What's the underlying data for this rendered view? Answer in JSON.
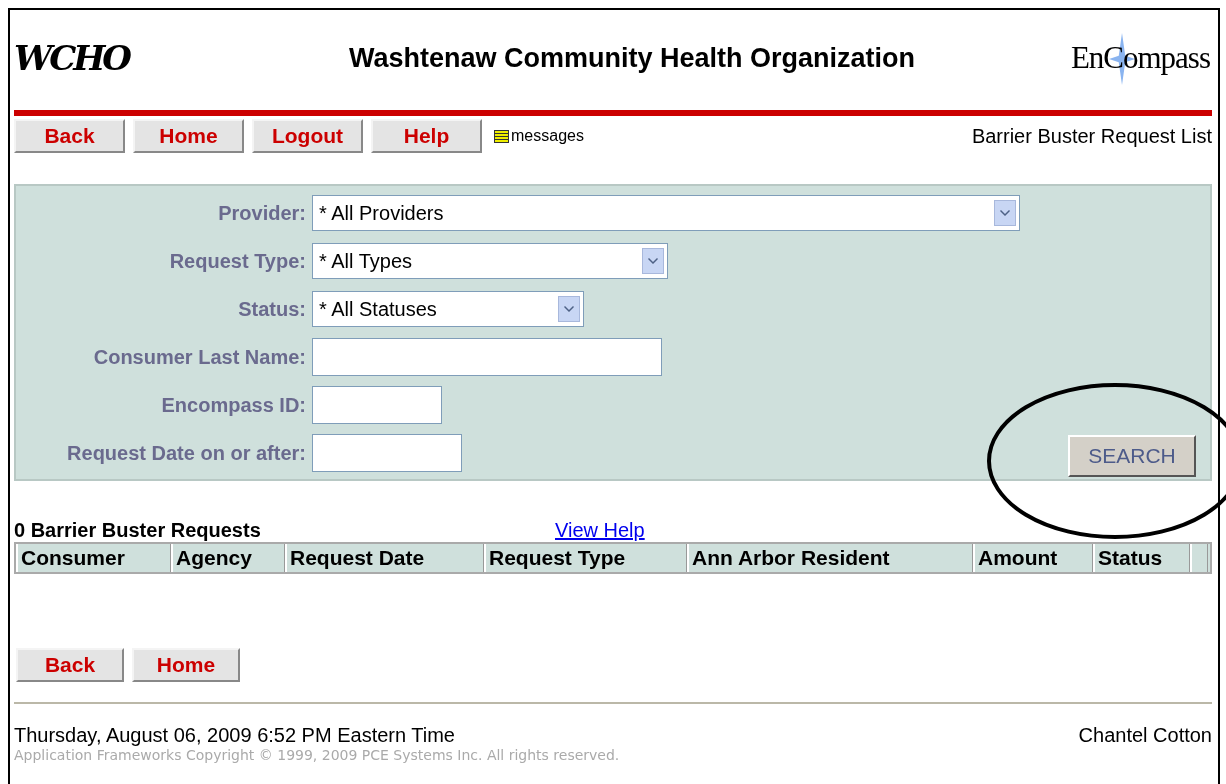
{
  "header": {
    "logo_left": "WCHO",
    "title": "Washtenaw Community Health Organization",
    "logo_right": "EnCompass"
  },
  "nav": {
    "buttons": [
      "Back",
      "Home",
      "Logout",
      "Help"
    ],
    "messages": "messages",
    "page_title": "Barrier Buster Request List"
  },
  "filters": [
    {
      "kind": "select",
      "label": "Provider:",
      "value": "* All Providers"
    },
    {
      "kind": "select",
      "label": "Request Type:",
      "value": "* All Types"
    },
    {
      "kind": "select",
      "label": "Status:",
      "value": "* All Statuses"
    },
    {
      "kind": "text",
      "label": "Consumer Last Name:"
    },
    {
      "kind": "text",
      "label": "Encompass ID:"
    },
    {
      "kind": "text",
      "label": "Request Date on or after:"
    }
  ],
  "search_button": {
    "label": "SEARCH",
    "circled": true
  },
  "results": {
    "count": "0 Barrier Buster Requests",
    "help_link": "View Help",
    "columns": [
      "Consumer",
      "Agency",
      "Request Date",
      "Request Type",
      "Ann Arbor Resident",
      "Amount",
      "Status"
    ]
  },
  "bottom_buttons": [
    "Back",
    "Home"
  ],
  "footer": {
    "datetime": "Thursday, August 06, 2009  6:52 PM Eastern Time",
    "user": "Chantel Cotton",
    "copyright": "Application Frameworks Copyright © 1999, 2009 PCE Systems Inc. All rights reserved."
  }
}
